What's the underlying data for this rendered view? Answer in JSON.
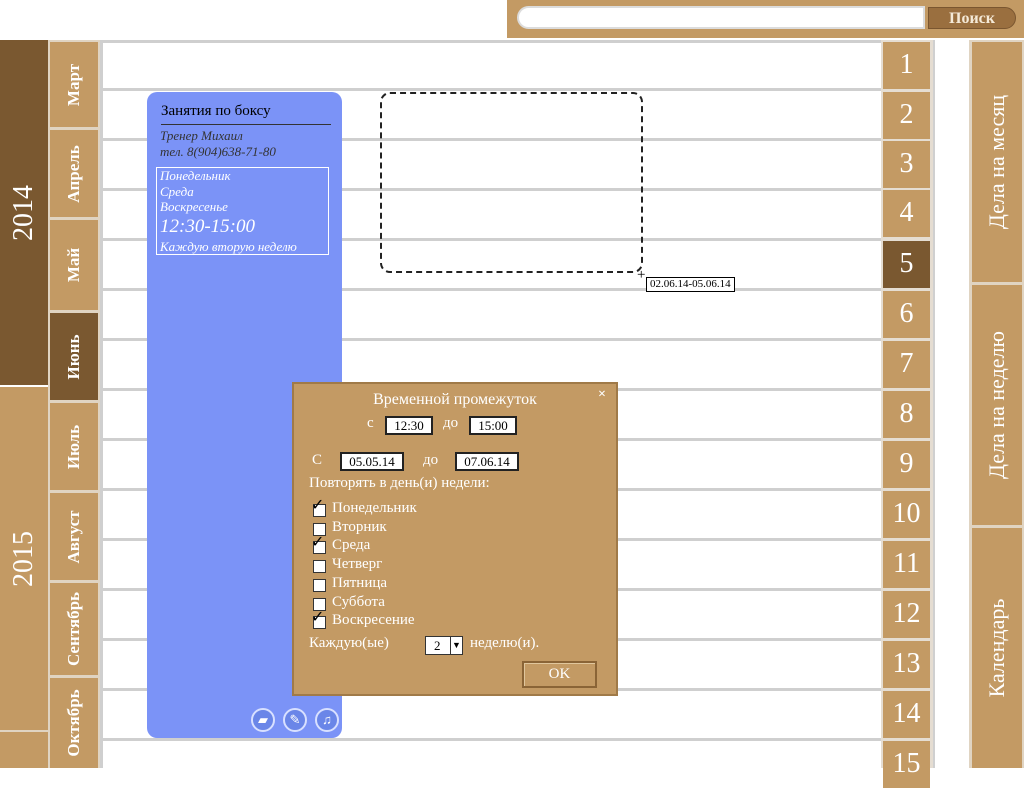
{
  "search": {
    "placeholder": "",
    "button_label": "Поиск"
  },
  "years": [
    {
      "label": "2014",
      "active": true
    },
    {
      "label": "2015",
      "active": false
    }
  ],
  "months": [
    {
      "label": "Март",
      "active": false
    },
    {
      "label": "Апрель",
      "active": false
    },
    {
      "label": "Май",
      "active": false
    },
    {
      "label": "Июнь",
      "active": true
    },
    {
      "label": "Июль",
      "active": false
    },
    {
      "label": "Август",
      "active": false
    },
    {
      "label": "Сентябрь",
      "active": false
    },
    {
      "label": "Октябрь",
      "active": false
    }
  ],
  "days": [
    "1",
    "2",
    "3",
    "4",
    "5",
    "6",
    "7",
    "8",
    "9",
    "10",
    "11",
    "12",
    "13",
    "14",
    "15"
  ],
  "active_day": "5",
  "right_tabs": {
    "month": "Дела на месяц",
    "week": "Дела на неделю",
    "calendar": "Календарь"
  },
  "event": {
    "title": "Занятия по боксу",
    "trainer": "Тренер Михаил",
    "phone": "тел. 8(904)638-71-80",
    "days": [
      "Понедельник",
      "Среда",
      "Воскресенье"
    ],
    "time": "12:30-15:00",
    "repeat": "Каждую вторую неделю"
  },
  "selection": {
    "cursor": "+",
    "range_label": "02.06.14-05.06.14"
  },
  "dialog": {
    "close": "×",
    "title": "Временной промежуток",
    "from_label": "с",
    "time_from": "12:30",
    "to_label": "до",
    "time_to": "15:00",
    "date_from_label": "С",
    "date_from": "05.05.14",
    "date_to_label": "до",
    "date_to": "07.06.14",
    "repeat_label": "Повторять в день(и) недели:",
    "weekdays": [
      {
        "label": "Понедельник",
        "checked": true
      },
      {
        "label": "Вторник",
        "checked": false
      },
      {
        "label": "Среда",
        "checked": true
      },
      {
        "label": "Четверг",
        "checked": false
      },
      {
        "label": "Пятница",
        "checked": false
      },
      {
        "label": "Суббота",
        "checked": false
      },
      {
        "label": "Воскресение",
        "checked": true
      }
    ],
    "every_label": "Каждую(ые)",
    "every_value": "2",
    "week_label": "неделю(и).",
    "ok": "OK"
  },
  "colors": {
    "tan": "#c39a64",
    "dark_brown": "#7a5830",
    "event_blue": "#7b93f7",
    "grid_line": "#cfcfcf"
  }
}
